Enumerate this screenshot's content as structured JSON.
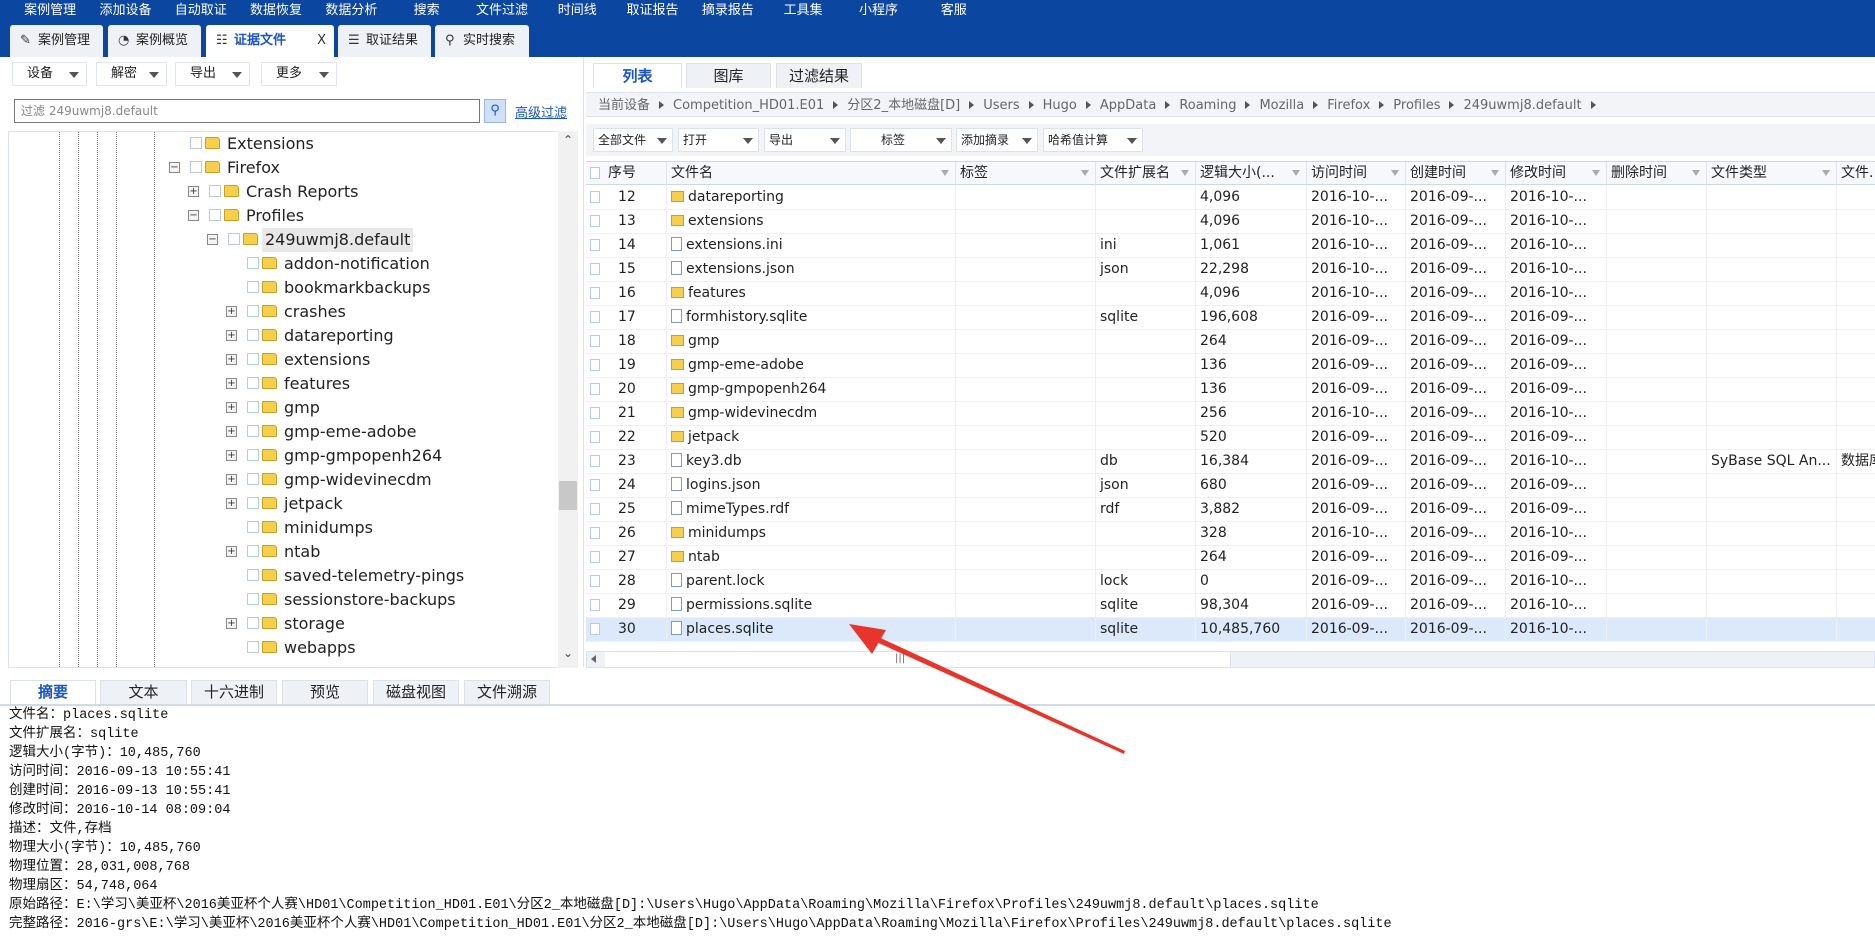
{
  "menu": [
    "案例管理",
    "添加设备",
    "自动取证",
    "数据恢复",
    "数据分析",
    "搜索",
    "文件过滤",
    "时间线",
    "取证报告",
    "摘录报告",
    "工具集",
    "小程序",
    "客服"
  ],
  "tabs": [
    {
      "label": "案例管理",
      "icon": "edit-icon"
    },
    {
      "label": "案例概览",
      "icon": "pie-chart-icon"
    },
    {
      "label": "证据文件",
      "icon": "tree-icon",
      "active": true,
      "closable": true
    },
    {
      "label": "取证结果",
      "icon": "list-check-icon"
    },
    {
      "label": "实时搜索",
      "icon": "search-icon"
    }
  ],
  "tab_close": "X",
  "left_toolbar": [
    "设备",
    "解密",
    "导出",
    "更多"
  ],
  "filter": {
    "placeholder": "过滤 249uwmj8.default",
    "advanced": "高级过滤"
  },
  "tree": [
    {
      "label": "Extensions",
      "level": 0,
      "exp": ""
    },
    {
      "label": "Firefox",
      "level": 0,
      "exp": "-"
    },
    {
      "label": "Crash Reports",
      "level": 1,
      "exp": "+"
    },
    {
      "label": "Profiles",
      "level": 1,
      "exp": "-"
    },
    {
      "label": "249uwmj8.default",
      "level": 2,
      "exp": "-",
      "selected": true
    },
    {
      "label": "addon-notification",
      "level": 3,
      "exp": ""
    },
    {
      "label": "bookmarkbackups",
      "level": 3,
      "exp": ""
    },
    {
      "label": "crashes",
      "level": 3,
      "exp": "+"
    },
    {
      "label": "datareporting",
      "level": 3,
      "exp": "+"
    },
    {
      "label": "extensions",
      "level": 3,
      "exp": "+"
    },
    {
      "label": "features",
      "level": 3,
      "exp": "+"
    },
    {
      "label": "gmp",
      "level": 3,
      "exp": "+"
    },
    {
      "label": "gmp-eme-adobe",
      "level": 3,
      "exp": "+"
    },
    {
      "label": "gmp-gmpopenh264",
      "level": 3,
      "exp": "+"
    },
    {
      "label": "gmp-widevinecdm",
      "level": 3,
      "exp": "+"
    },
    {
      "label": "jetpack",
      "level": 3,
      "exp": "+"
    },
    {
      "label": "minidumps",
      "level": 3,
      "exp": ""
    },
    {
      "label": "ntab",
      "level": 3,
      "exp": "+"
    },
    {
      "label": "saved-telemetry-pings",
      "level": 3,
      "exp": ""
    },
    {
      "label": "sessionstore-backups",
      "level": 3,
      "exp": ""
    },
    {
      "label": "storage",
      "level": 3,
      "exp": "+"
    },
    {
      "label": "webapps",
      "level": 3,
      "exp": ""
    }
  ],
  "right_tabs": [
    "列表",
    "图库",
    "过滤结果"
  ],
  "breadcrumb": [
    "当前设备",
    "Competition_HD01.E01",
    "分区2_本地磁盘[D]",
    "Users",
    "Hugo",
    "AppData",
    "Roaming",
    "Mozilla",
    "Firefox",
    "Profiles",
    "249uwmj8.default"
  ],
  "right_toolbar": [
    "全部文件",
    "打开",
    "导出",
    "标签",
    "添加摘录",
    "哈希值计算"
  ],
  "columns": [
    "序号",
    "文件名",
    "标签",
    "文件扩展名",
    "逻辑大小(...",
    "访问时间",
    "创建时间",
    "修改时间",
    "删除时间",
    "文件类型",
    "文件..."
  ],
  "rows": [
    {
      "no": "12",
      "name": "datareporting",
      "type": "folder",
      "tag": "",
      "ext": "",
      "size": "4,096",
      "atime": "2016-10-...",
      "ctime": "2016-09-...",
      "mtime": "2016-10-...",
      "dtime": "",
      "ftype": "",
      "fcat": ""
    },
    {
      "no": "13",
      "name": "extensions",
      "type": "folder",
      "tag": "",
      "ext": "",
      "size": "4,096",
      "atime": "2016-10-...",
      "ctime": "2016-09-...",
      "mtime": "2016-10-...",
      "dtime": "",
      "ftype": "",
      "fcat": ""
    },
    {
      "no": "14",
      "name": "extensions.ini",
      "type": "file",
      "tag": "",
      "ext": "ini",
      "size": "1,061",
      "atime": "2016-10-...",
      "ctime": "2016-09-...",
      "mtime": "2016-10-...",
      "dtime": "",
      "ftype": "",
      "fcat": ""
    },
    {
      "no": "15",
      "name": "extensions.json",
      "type": "file",
      "tag": "",
      "ext": "json",
      "size": "22,298",
      "atime": "2016-10-...",
      "ctime": "2016-09-...",
      "mtime": "2016-10-...",
      "dtime": "",
      "ftype": "",
      "fcat": ""
    },
    {
      "no": "16",
      "name": "features",
      "type": "folder",
      "tag": "",
      "ext": "",
      "size": "4,096",
      "atime": "2016-10-...",
      "ctime": "2016-09-...",
      "mtime": "2016-10-...",
      "dtime": "",
      "ftype": "",
      "fcat": ""
    },
    {
      "no": "17",
      "name": "formhistory.sqlite",
      "type": "file",
      "tag": "",
      "ext": "sqlite",
      "size": "196,608",
      "atime": "2016-09-...",
      "ctime": "2016-09-...",
      "mtime": "2016-09-...",
      "dtime": "",
      "ftype": "",
      "fcat": ""
    },
    {
      "no": "18",
      "name": "gmp",
      "type": "folder",
      "tag": "",
      "ext": "",
      "size": "264",
      "atime": "2016-09-...",
      "ctime": "2016-09-...",
      "mtime": "2016-09-...",
      "dtime": "",
      "ftype": "",
      "fcat": ""
    },
    {
      "no": "19",
      "name": "gmp-eme-adobe",
      "type": "folder",
      "tag": "",
      "ext": "",
      "size": "136",
      "atime": "2016-09-...",
      "ctime": "2016-09-...",
      "mtime": "2016-09-...",
      "dtime": "",
      "ftype": "",
      "fcat": ""
    },
    {
      "no": "20",
      "name": "gmp-gmpopenh264",
      "type": "folder",
      "tag": "",
      "ext": "",
      "size": "136",
      "atime": "2016-09-...",
      "ctime": "2016-09-...",
      "mtime": "2016-09-...",
      "dtime": "",
      "ftype": "",
      "fcat": ""
    },
    {
      "no": "21",
      "name": "gmp-widevinecdm",
      "type": "folder",
      "tag": "",
      "ext": "",
      "size": "256",
      "atime": "2016-10-...",
      "ctime": "2016-09-...",
      "mtime": "2016-10-...",
      "dtime": "",
      "ftype": "",
      "fcat": ""
    },
    {
      "no": "22",
      "name": "jetpack",
      "type": "folder",
      "tag": "",
      "ext": "",
      "size": "520",
      "atime": "2016-09-...",
      "ctime": "2016-09-...",
      "mtime": "2016-09-...",
      "dtime": "",
      "ftype": "",
      "fcat": ""
    },
    {
      "no": "23",
      "name": "key3.db",
      "type": "file",
      "tag": "",
      "ext": "db",
      "size": "16,384",
      "atime": "2016-09-...",
      "ctime": "2016-09-...",
      "mtime": "2016-10-...",
      "dtime": "",
      "ftype": "SyBase SQL An...",
      "fcat": "数据库"
    },
    {
      "no": "24",
      "name": "logins.json",
      "type": "file",
      "tag": "",
      "ext": "json",
      "size": "680",
      "atime": "2016-09-...",
      "ctime": "2016-09-...",
      "mtime": "2016-09-...",
      "dtime": "",
      "ftype": "",
      "fcat": ""
    },
    {
      "no": "25",
      "name": "mimeTypes.rdf",
      "type": "file",
      "tag": "",
      "ext": "rdf",
      "size": "3,882",
      "atime": "2016-09-...",
      "ctime": "2016-09-...",
      "mtime": "2016-09-...",
      "dtime": "",
      "ftype": "",
      "fcat": ""
    },
    {
      "no": "26",
      "name": "minidumps",
      "type": "folder",
      "tag": "",
      "ext": "",
      "size": "328",
      "atime": "2016-10-...",
      "ctime": "2016-09-...",
      "mtime": "2016-10-...",
      "dtime": "",
      "ftype": "",
      "fcat": ""
    },
    {
      "no": "27",
      "name": "ntab",
      "type": "folder",
      "tag": "",
      "ext": "",
      "size": "264",
      "atime": "2016-09-...",
      "ctime": "2016-09-...",
      "mtime": "2016-09-...",
      "dtime": "",
      "ftype": "",
      "fcat": ""
    },
    {
      "no": "28",
      "name": "parent.lock",
      "type": "file",
      "tag": "",
      "ext": "lock",
      "size": "0",
      "atime": "2016-09-...",
      "ctime": "2016-09-...",
      "mtime": "2016-10-...",
      "dtime": "",
      "ftype": "",
      "fcat": ""
    },
    {
      "no": "29",
      "name": "permissions.sqlite",
      "type": "file",
      "tag": "",
      "ext": "sqlite",
      "size": "98,304",
      "atime": "2016-09-...",
      "ctime": "2016-09-...",
      "mtime": "2016-10-...",
      "dtime": "",
      "ftype": "",
      "fcat": ""
    },
    {
      "no": "30",
      "name": "places.sqlite",
      "type": "file",
      "tag": "",
      "ext": "sqlite",
      "size": "10,485,760",
      "atime": "2016-09-...",
      "ctime": "2016-09-...",
      "mtime": "2016-10-...",
      "dtime": "",
      "ftype": "",
      "fcat": "",
      "selected": true
    }
  ],
  "bottom_tabs": [
    "摘要",
    "文本",
    "十六进制",
    "预览",
    "磁盘视图",
    "文件溯源"
  ],
  "details": [
    "文件名：places.sqlite",
    "文件扩展名：sqlite",
    "逻辑大小(字节)：10,485,760",
    "访问时间：2016-09-13 10:55:41",
    "创建时间：2016-09-13 10:55:41",
    "修改时间：2016-10-14 08:09:04",
    "描述：文件,存档",
    "物理大小(字节)：10,485,760",
    "物理位置：28,031,008,768",
    "物理扇区：54,748,064",
    "原始路径：E:\\学习\\美亚杯\\2016美亚杯个人赛\\HD01\\Competition_HD01.E01\\分区2_本地磁盘[D]:\\Users\\Hugo\\AppData\\Roaming\\Mozilla\\Firefox\\Profiles\\249uwmj8.default\\places.sqlite",
    "完整路径：2016-grs\\E:\\学习\\美亚杯\\2016美亚杯个人赛\\HD01\\Competition_HD01.E01\\分区2_本地磁盘[D]:\\Users\\Hugo\\AppData\\Roaming\\Mozilla\\Firefox\\Profiles\\249uwmj8.default\\places.sqlite"
  ],
  "colors": {
    "menu_bg": "#0b46a0",
    "accent": "#1a55c8",
    "selection": "#dbe9fb",
    "annotation_arrow": "#e8352b"
  }
}
